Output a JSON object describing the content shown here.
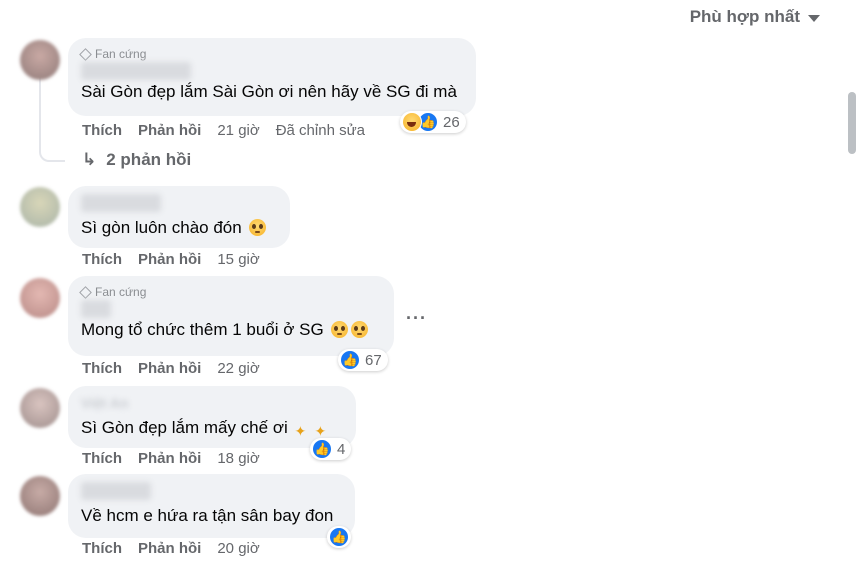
{
  "sort": {
    "label": "Phù hợp nhất"
  },
  "actions": {
    "like": "Thích",
    "reply": "Phản hồi"
  },
  "colors": {
    "like_blue": "#1877f2",
    "bubble_bg": "#f0f2f5",
    "meta_gray": "#65676b"
  },
  "comments": [
    {
      "badge": "Fan cứng",
      "name": "",
      "text": "Sài Gòn đẹp lắm Sài Gòn ơi nên hãy về SG đi mà",
      "time": "21 giờ",
      "edited": "Đã chỉnh sửa",
      "reaction_count": "26",
      "reactions": [
        "haha",
        "like"
      ],
      "replies_label": "2 phản hồi"
    },
    {
      "badge": "",
      "name": "",
      "text": "Sì gòn luôn chào đón",
      "time": "15 giờ",
      "reaction_count": ""
    },
    {
      "badge": "Fan cứng",
      "name": "",
      "text": "Mong tổ chức thêm 1 buổi ở SG",
      "time": "22 giờ",
      "reaction_count": "67",
      "reactions": [
        "like"
      ]
    },
    {
      "badge": "",
      "name": "Việt An",
      "text": "Sì Gòn đẹp lắm mấy chế ơi",
      "time": "18 giờ",
      "reaction_count": "4",
      "reactions": [
        "like"
      ]
    },
    {
      "badge": "",
      "name": "",
      "text": "Về hcm e hứa ra tận sân bay đon",
      "time": "20 giờ",
      "reaction_count": "",
      "reactions": [
        "like"
      ]
    }
  ]
}
